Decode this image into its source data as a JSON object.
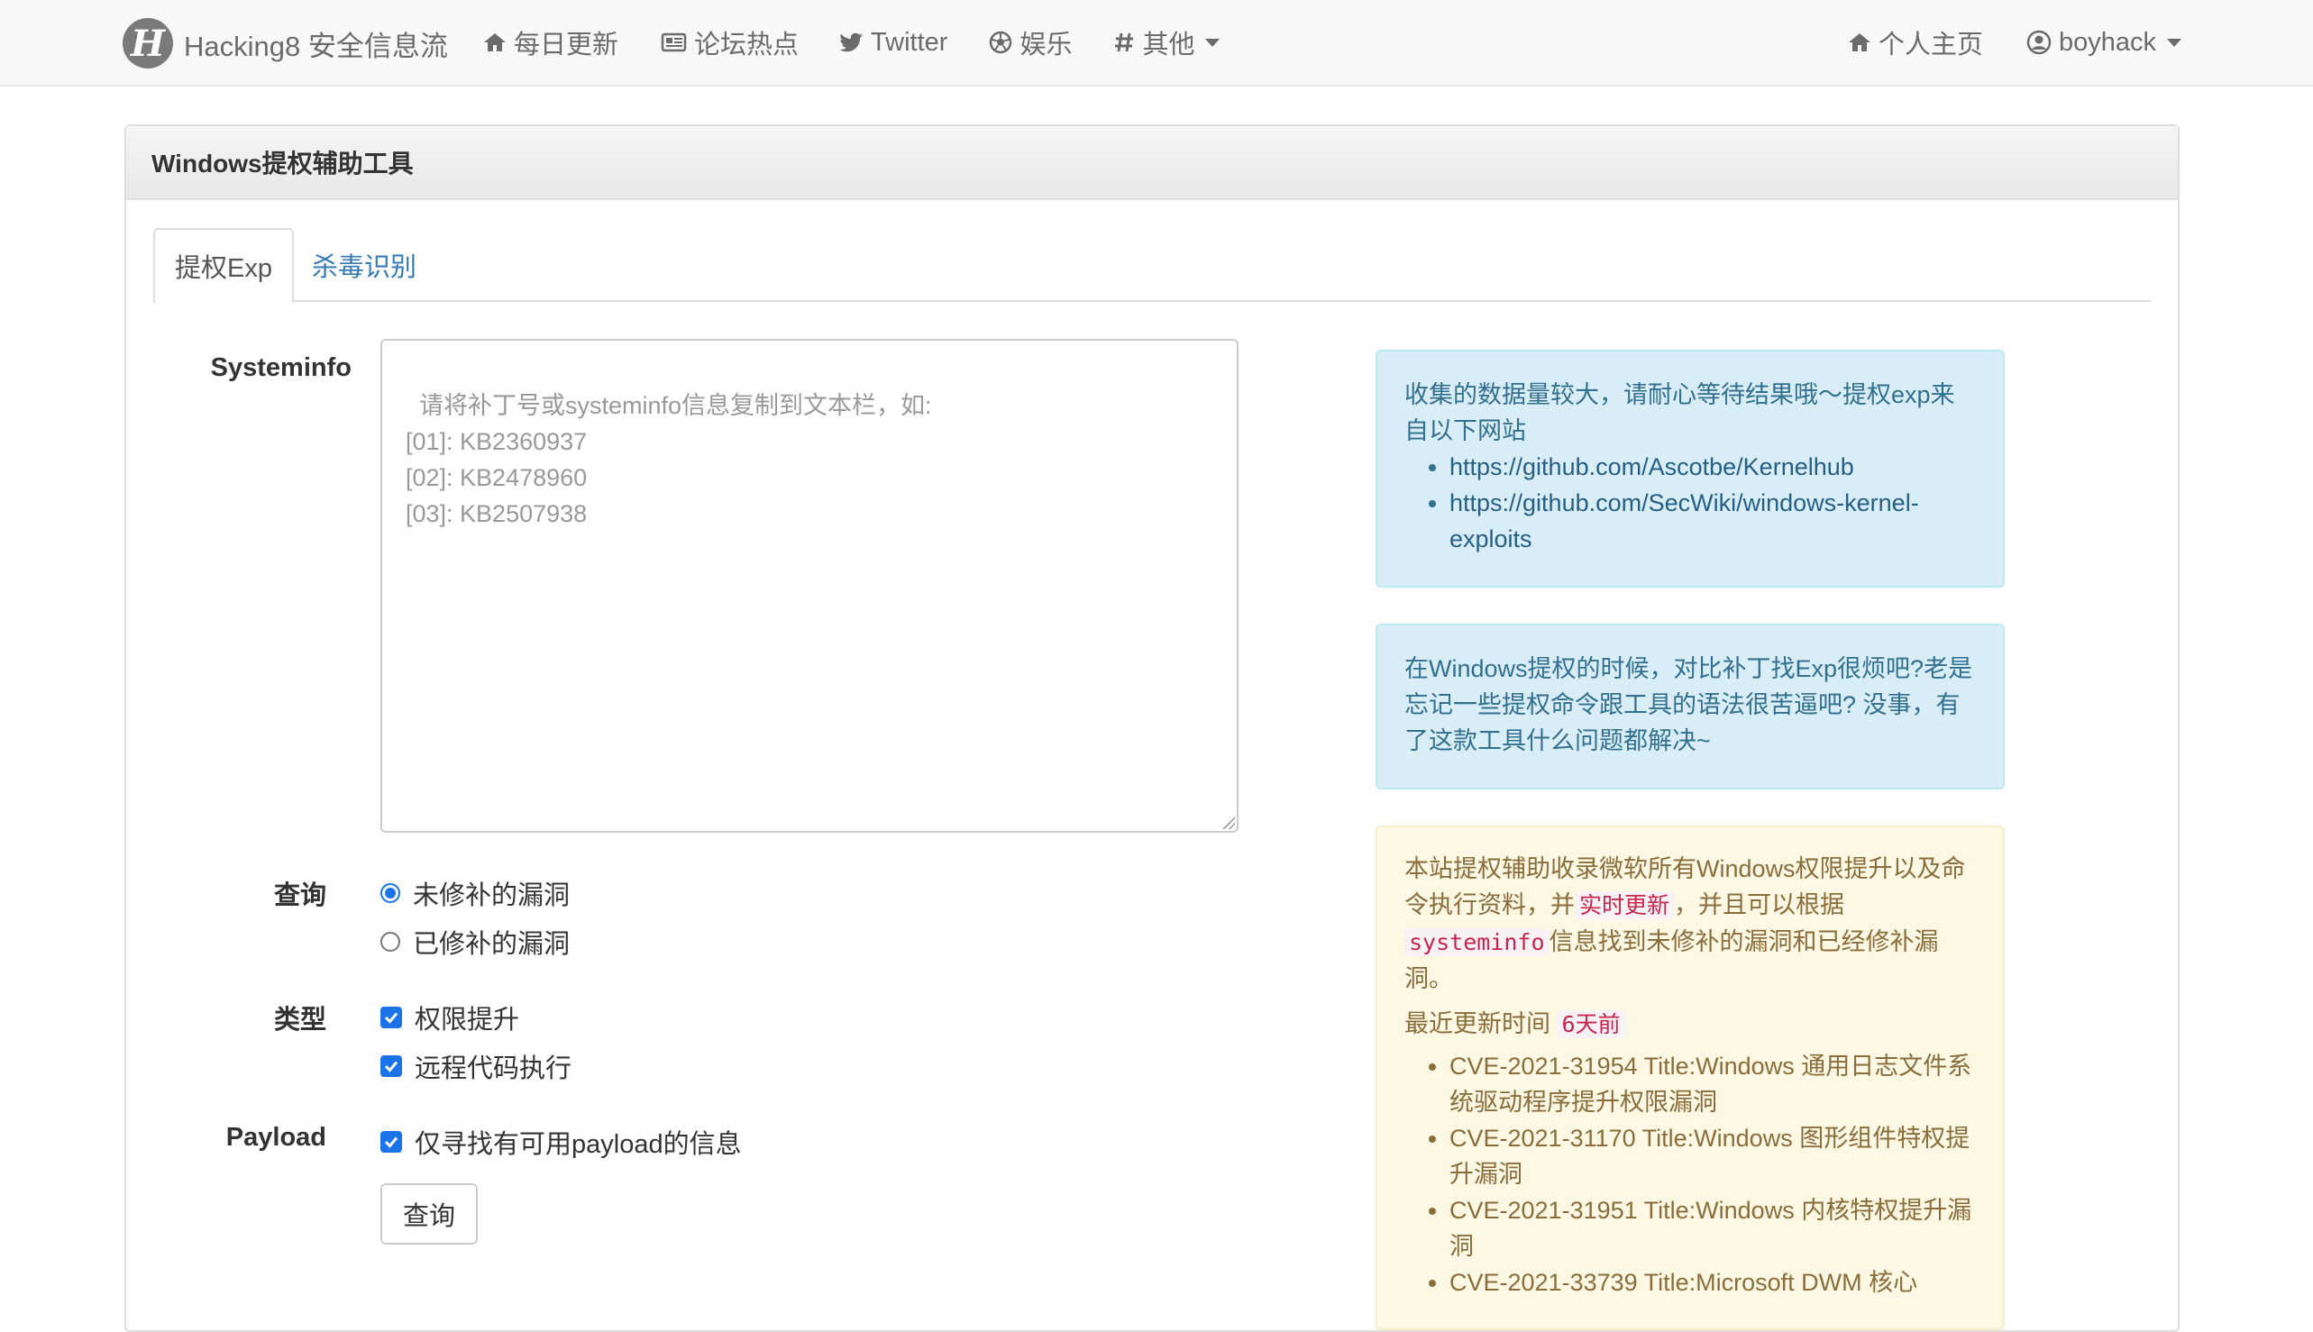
{
  "navbar": {
    "logo_letter": "H",
    "brand": "Hacking8 安全信息流",
    "items": [
      {
        "label": "每日更新",
        "icon": "home-icon"
      },
      {
        "label": "论坛热点",
        "icon": "newspaper-icon"
      },
      {
        "label": "Twitter",
        "icon": "twitter-icon"
      },
      {
        "label": "娱乐",
        "icon": "soccer-ball-icon"
      },
      {
        "label": "其他",
        "icon": "hashtag-icon"
      }
    ],
    "right": [
      {
        "label": "个人主页",
        "icon": "home-icon"
      },
      {
        "label": "boyhack",
        "icon": "user-circle-icon"
      }
    ]
  },
  "panel": {
    "title": "Windows提权辅助工具",
    "tabs": [
      {
        "label": "提权Exp",
        "active": true
      },
      {
        "label": "杀毒识别",
        "active": false
      }
    ]
  },
  "form": {
    "systeminfo_label": "Systeminfo",
    "systeminfo_placeholder": "请将补丁号或systeminfo信息复制到文本栏，如:\n[01]: KB2360937\n[02]: KB2478960\n[03]: KB2507938",
    "query_label": "查询",
    "query_options": [
      {
        "label": "未修补的漏洞",
        "selected": true
      },
      {
        "label": "已修补的漏洞",
        "selected": false
      }
    ],
    "type_label": "类型",
    "type_options": [
      {
        "label": "权限提升",
        "checked": true
      },
      {
        "label": "远程代码执行",
        "checked": true
      }
    ],
    "payload_label": "Payload",
    "payload_option": {
      "label": "仅寻找有可用payload的信息",
      "checked": true
    },
    "submit_label": "查询"
  },
  "info_box1": {
    "text": "收集的数据量较大，请耐心等待结果哦～提权exp来自以下网站",
    "links": [
      "https://github.com/Ascotbe/Kernelhub",
      "https://github.com/SecWiki/windows-kernel-exploits"
    ]
  },
  "info_box2": {
    "text": "在Windows提权的时候，对比补丁找Exp很烦吧?老是忘记一些提权命令跟工具的语法很苦逼吧? 没事，有了这款工具什么问题都解决~"
  },
  "warn_box": {
    "text_a": "本站提权辅助收录微软所有Windows权限提升以及命令执行资料，并",
    "code_a": "实时更新",
    "text_b": "，并且可以根据",
    "code_b": "systeminfo",
    "text_c": "信息找到未修补的漏洞和已经修补漏洞。",
    "updated_label": "最近更新时间",
    "updated_value": "6天前",
    "items": [
      "CVE-2021-31954 Title:Windows 通用日志文件系统驱动程序提升权限漏洞",
      "CVE-2021-31170 Title:Windows 图形组件特权提升漏洞",
      "CVE-2021-31951 Title:Windows 内核特权提升漏洞",
      "CVE-2021-33739 Title:Microsoft DWM 核心"
    ]
  },
  "colors": {
    "navbar_bg": "#f8f8f8",
    "link": "#337ab7",
    "info_bg": "#d9edf7",
    "warn_bg": "#fcf8e3",
    "accent": "#1a73e8"
  }
}
